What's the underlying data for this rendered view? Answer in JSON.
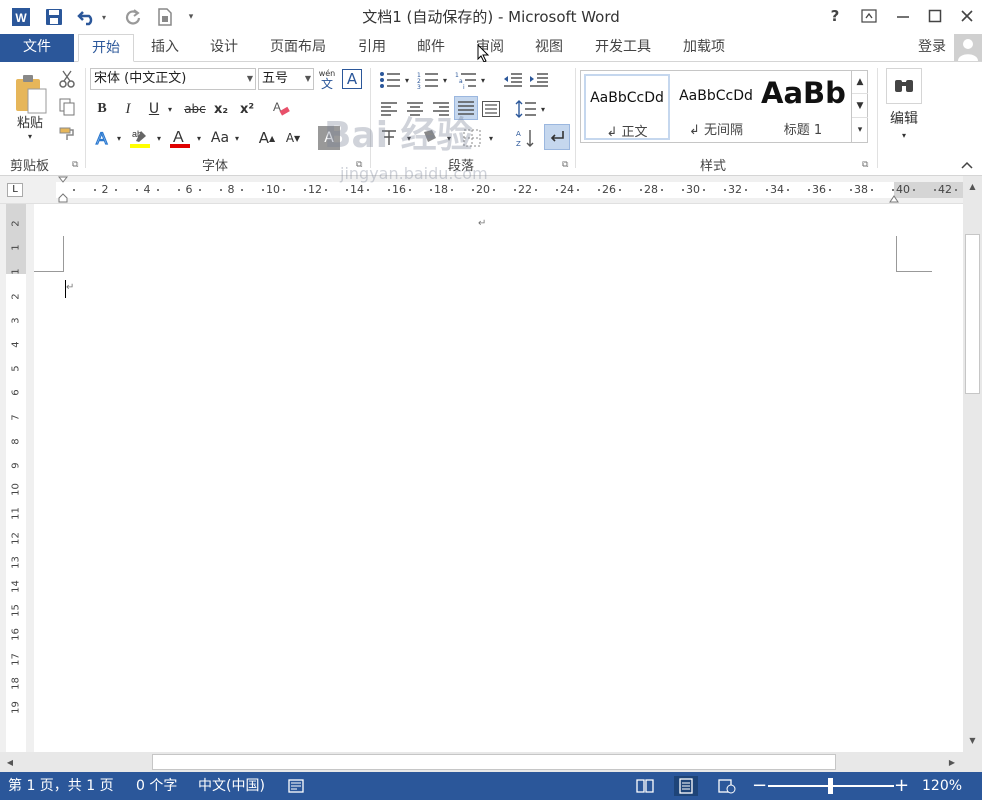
{
  "window": {
    "title": "文档1 (自动保存的) - Microsoft Word",
    "help_label": "?",
    "restore_label": "▭",
    "minimize_label": "—",
    "maximize_label": "☐",
    "close_label": "✕"
  },
  "quick_access": {
    "app_icon": "W",
    "save_icon": "save-icon",
    "undo_icon": "undo-icon",
    "redo_icon": "redo-icon",
    "print_icon": "print-preview-icon",
    "customize_icon": "customize-icon"
  },
  "tabs": [
    {
      "label": "文件"
    },
    {
      "label": "开始"
    },
    {
      "label": "插入"
    },
    {
      "label": "设计"
    },
    {
      "label": "页面布局"
    },
    {
      "label": "引用"
    },
    {
      "label": "邮件"
    },
    {
      "label": "审阅"
    },
    {
      "label": "视图"
    },
    {
      "label": "开发工具"
    },
    {
      "label": "加载项"
    }
  ],
  "login_label": "登录",
  "ribbon": {
    "clipboard": {
      "paste_label": "粘贴",
      "group_label": "剪贴板"
    },
    "font": {
      "font_name": "宋体 (中文正文)",
      "font_size": "五号",
      "bold": "B",
      "italic": "I",
      "underline": "U",
      "strikethrough": "abc",
      "subscript": "x₂",
      "superscript": "x²",
      "font_color_letter": "A",
      "change_case": "Aa",
      "grow_font": "A",
      "shrink_font": "A",
      "phonetic_top": "wén",
      "phonetic_bottom": "文",
      "char_border": "A",
      "group_label": "字体"
    },
    "paragraph": {
      "group_label": "段落"
    },
    "styles": {
      "items": [
        {
          "preview": "AaBbCcDd",
          "name": "↲ 正文"
        },
        {
          "preview": "AaBbCcDd",
          "name": "↲ 无间隔"
        },
        {
          "preview": "AaBb",
          "name": "标题 1"
        }
      ],
      "group_label": "样式"
    },
    "editing": {
      "label": "编辑"
    }
  },
  "ruler": {
    "h_ticks": [
      "2",
      "4",
      "6",
      "8",
      "10",
      "12",
      "14",
      "16",
      "18",
      "20",
      "22",
      "24",
      "26",
      "28",
      "30",
      "32",
      "34",
      "36",
      "38",
      "40",
      "42"
    ],
    "v_ticks": [
      "2",
      "1",
      "1",
      "2",
      "3",
      "4",
      "5",
      "6",
      "7",
      "8",
      "9",
      "10",
      "11",
      "12",
      "13",
      "14",
      "15",
      "16",
      "17",
      "18",
      "19"
    ],
    "tab_selector": "L"
  },
  "document": {
    "paragraph_mark": "↵",
    "header_mark": "↵"
  },
  "status": {
    "page": "第 1 页，共 1 页",
    "words": "0 个字",
    "language": "中文(中国)",
    "zoom": "120%",
    "zoom_minus": "−",
    "zoom_plus": "+"
  },
  "watermark": {
    "text": "Bai 经验",
    "url": "jingyan.baidu.com"
  },
  "colors": {
    "accent": "#2b579a",
    "highlight_yellow": "#ffff00",
    "font_red": "#e00000"
  }
}
